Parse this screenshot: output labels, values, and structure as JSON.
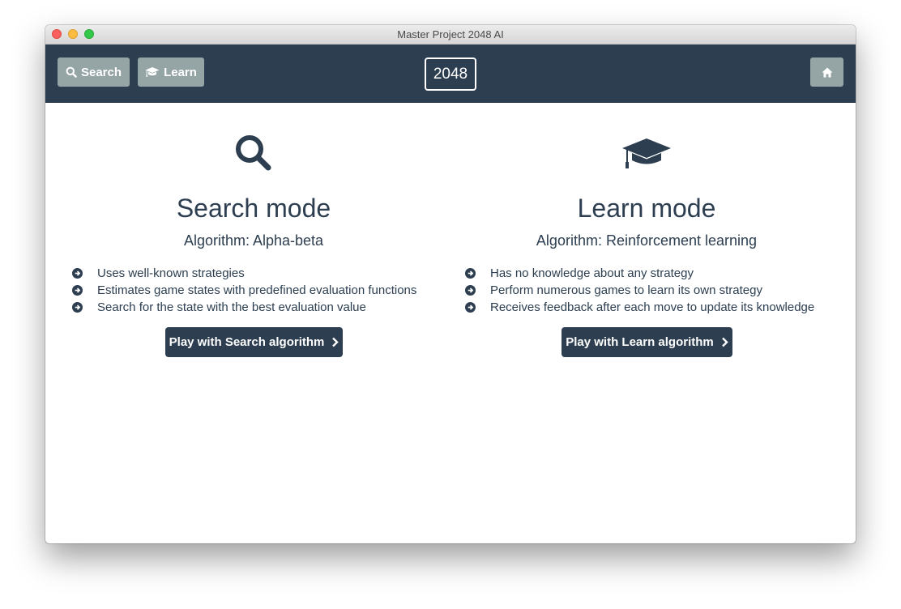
{
  "window": {
    "title": "Master Project 2048 AI"
  },
  "navbar": {
    "search_label": "Search",
    "learn_label": "Learn",
    "brand": "2048",
    "icons": {
      "search": "search-icon",
      "learn": "graduation-cap-icon",
      "home": "home-icon"
    }
  },
  "modes": [
    {
      "icon": "search-icon",
      "title": "Search mode",
      "algorithm": "Algorithm: Alpha-beta",
      "features": [
        "Uses well-known strategies",
        "Estimates game states with predefined evaluation functions",
        "Search for the state with the best evaluation value"
      ],
      "button_label": "Play with Search algorithm"
    },
    {
      "icon": "graduation-cap-icon",
      "title": "Learn mode",
      "algorithm": "Algorithm: Reinforcement learning",
      "features": [
        "Has no knowledge about any strategy",
        "Perform numerous games to learn its own strategy",
        "Receives feedback after each move to update its knowledge"
      ],
      "button_label": "Play with Learn algorithm"
    }
  ],
  "colors": {
    "navbar": "#2c3e50",
    "nav_button": "#95a5a6",
    "text": "#2c3e50",
    "primary_button": "#2c3e50"
  }
}
